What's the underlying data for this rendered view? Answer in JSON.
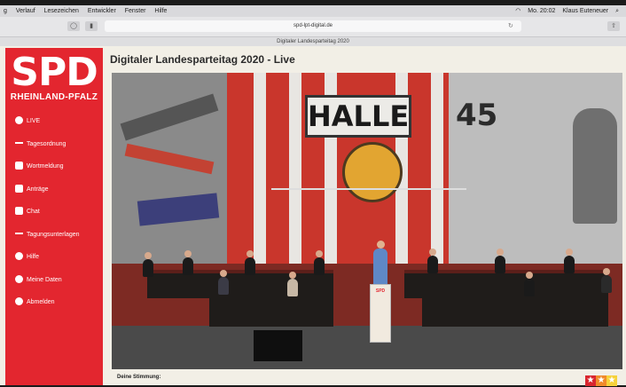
{
  "menubar": {
    "items": [
      "g",
      "Verlauf",
      "Lesezeichen",
      "Entwickler",
      "Fenster",
      "Hilfe"
    ],
    "clock": "Mo. 20:02",
    "user": "Klaus Euteneuer"
  },
  "browser": {
    "url": "spd-lpt-digital.de",
    "tab_title": "Digitaler Landesparteitag 2020"
  },
  "sidebar": {
    "logo_main": "SPD",
    "logo_region": "RHEINLAND-PFALZ",
    "items": [
      {
        "label": "LIVE",
        "icon": "globe-icon"
      },
      {
        "label": "Tagesordnung",
        "icon": "agenda-icon"
      },
      {
        "label": "Wortmeldung",
        "icon": "speech-icon"
      },
      {
        "label": "Anträge",
        "icon": "document-icon"
      },
      {
        "label": "Chat",
        "icon": "chat-icon"
      },
      {
        "label": "Tagungsunterlagen",
        "icon": "download-icon"
      },
      {
        "label": "Hilfe",
        "icon": "help-icon"
      },
      {
        "label": "Meine Daten",
        "icon": "user-icon"
      },
      {
        "label": "Abmelden",
        "icon": "power-icon"
      }
    ]
  },
  "main": {
    "title": "Digitaler Landesparteitag 2020 - Live",
    "video": {
      "sign_text": "HALLE",
      "wall_number": "45",
      "podium_label": "SPD"
    },
    "mood_label": "Deine Stimmung:",
    "mood_stars": 3
  },
  "colors": {
    "brand_red": "#e3262f",
    "page_bg": "#f2efe6"
  }
}
